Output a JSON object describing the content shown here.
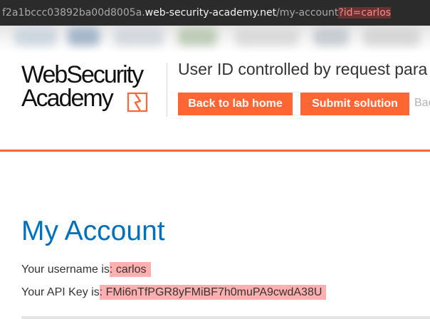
{
  "browser": {
    "url_prefix": "f2a1bccc03892ba00d8005a.",
    "url_host": "web-security-academy.net",
    "url_path": "/my-account",
    "url_query": "?id=carlos"
  },
  "header": {
    "logo_line1": "WebSecurity",
    "logo_line2": "Academy",
    "lab_title": "User ID controlled by request para",
    "back_button": "Back to lab home",
    "submit_button": "Submit solution",
    "back_link_partial": "Bac"
  },
  "content": {
    "page_title": "My Account",
    "username_label": "Your username is",
    "username_value": ": carlos",
    "apikey_label": "Your API Key is",
    "apikey_value": ": FMi6nTfPGR8yFMiBF7h0muPA9cwdA38U"
  },
  "colors": {
    "accent": "#ff6633",
    "title": "#0071bc",
    "highlight": "#ff6e6e"
  }
}
